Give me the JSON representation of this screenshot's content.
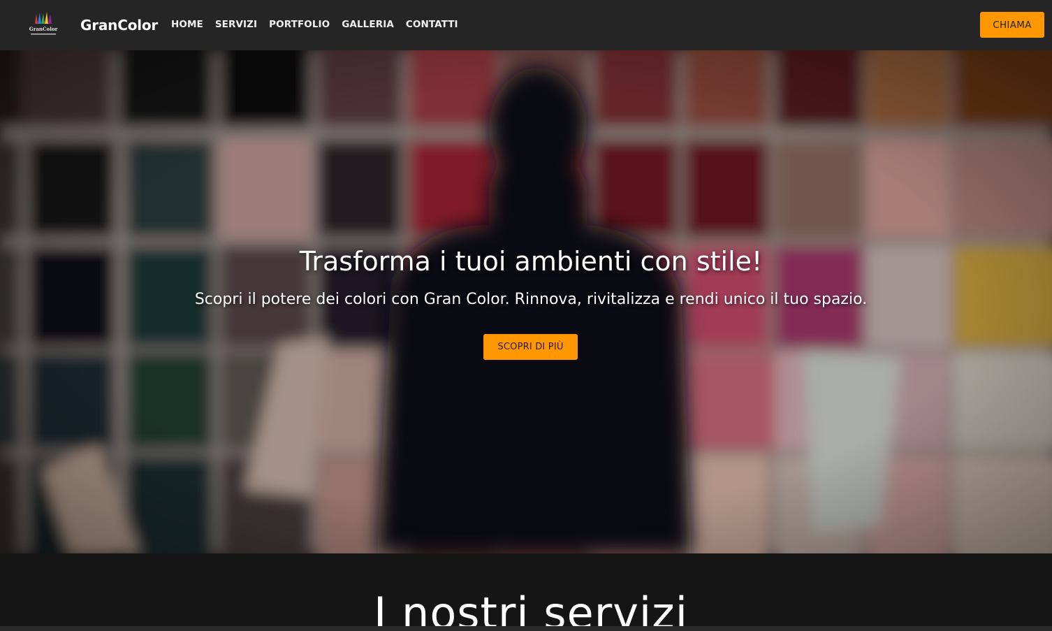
{
  "brand": {
    "name": "GranColor",
    "logo_text": "GranColor"
  },
  "nav": {
    "links": [
      "HOME",
      "SERVIZI",
      "PORTFOLIO",
      "GALLERIA",
      "CONTATTI"
    ],
    "call_label": "CHIAMA"
  },
  "hero": {
    "title": "Trasforma i tuoi ambienti con stile!",
    "subtitle": "Scopri il potere dei colori con Gran Color. Rinnova, rivitalizza e rendi unico il tuo spazio.",
    "cta_label": "SCOPRI DI PIÙ"
  },
  "services": {
    "title": "I nostri servizi"
  },
  "colors": {
    "accent": "#ff9800",
    "navbar_bg": "#252525",
    "page_bg": "#151515"
  }
}
